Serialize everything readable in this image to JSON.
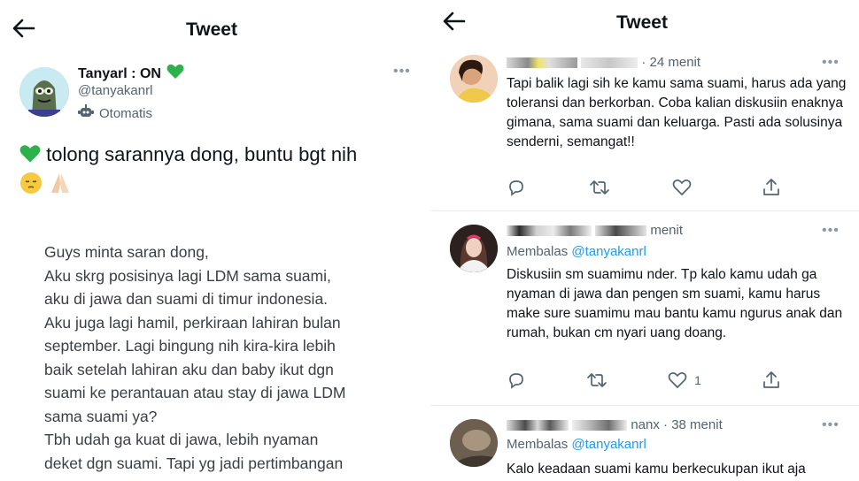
{
  "left": {
    "header_title": "Tweet",
    "author": {
      "name": "Tanyarl : ON",
      "handle": "@tanyakanrl",
      "automated_label": "Otomatis"
    },
    "headline": "tolong sarannya dong, buntu bgt nih",
    "body_lines": [
      "Guys minta saran dong,",
      "Aku skrg posisinya lagi LDM sama suami,",
      "aku di jawa dan suami di timur indonesia.",
      "Aku juga lagi hamil, perkiraan lahiran bulan",
      "september. Lagi bingung nih kira-kira lebih",
      "baik setelah lahiran aku dan baby ikut dgn",
      "suami ke perantauan atau stay di jawa LDM",
      "sama suami ya?",
      "Tbh udah ga kuat di jawa, lebih nyaman",
      "deket dgn suami. Tapi yg jadi pertimbangan"
    ]
  },
  "right": {
    "header_title": "Tweet",
    "replies": [
      {
        "time": "· 24 menit",
        "text": "Tapi balik lagi sih ke kamu sama suami, harus ada yang toleransi dan berkorban. Coba kalian diskusiin enaknya gimana, sama suami dan keluarga. Pasti ada solusinya senderni, semangat!!",
        "like_count": ""
      },
      {
        "time": "menit",
        "replying_label": "Membalas",
        "replying_to": "@tanyakanrl",
        "text": "Diskusiin sm suamimu nder. Tp kalo kamu udah ga nyaman di jawa dan pengen sm suami, kamu harus make sure suamimu mau bantu kamu ngurus anak dan rumah, bukan cm nyari uang doang.",
        "like_count": "1"
      },
      {
        "time": "nanx · 38 menit",
        "replying_label": "Membalas",
        "replying_to": "@tanyakanrl",
        "text": "Kalo keadaan suami kamu berkecukupan ikut aja",
        "like_count": ""
      }
    ]
  },
  "colors": {
    "text": "#0f1419",
    "secondary": "#536471",
    "link": "#1d9bf0",
    "heart_green": "#2db14b",
    "divider": "#e6ecf0"
  },
  "icons": [
    "back-arrow-icon",
    "more-dots-icon",
    "robot-icon",
    "reply-icon",
    "retweet-icon",
    "like-icon",
    "share-icon"
  ]
}
